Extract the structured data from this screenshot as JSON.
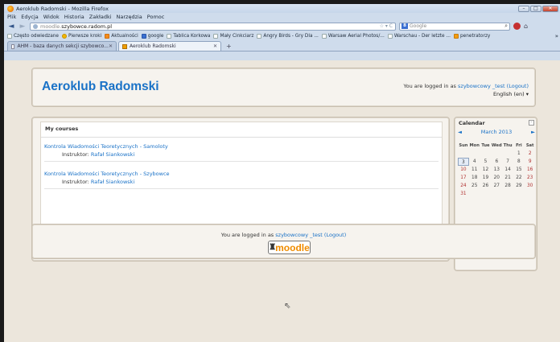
{
  "window": {
    "title": "Aeroklub Radomski - Mozilla Firefox",
    "buttons": {
      "minimize": "–",
      "maximize": "□",
      "close": "✕"
    }
  },
  "menu": [
    "Plik",
    "Edycja",
    "Widok",
    "Historia",
    "Zakładki",
    "Narzędzia",
    "Pomoc"
  ],
  "nav": {
    "url_host": "moodle.",
    "url_domain": "szybowce.radom.pl",
    "url_right": "☆ ▾ C",
    "search_placeholder": "Google",
    "search_engine_letter": "8"
  },
  "bookmarks": [
    {
      "label": "Często odwiedzane",
      "icon": "bookmark-icon"
    },
    {
      "label": "Pierwsze kroki",
      "icon": "star-icon"
    },
    {
      "label": "Aktualności",
      "icon": "rss-icon"
    },
    {
      "label": "google",
      "icon": "google-icon"
    },
    {
      "label": "Tablica Korkowa",
      "icon": "page-icon"
    },
    {
      "label": "Mały Cinkciarz",
      "icon": "page-icon"
    },
    {
      "label": "Angry Birds - Gry Dla ...",
      "icon": "page-icon"
    },
    {
      "label": "Warsaw Aerial Photos/...",
      "icon": "page-icon"
    },
    {
      "label": "Warschau - Der letzte ...",
      "icon": "page-icon"
    },
    {
      "label": "penetratorzy",
      "icon": "blogger-icon"
    }
  ],
  "tabs": [
    {
      "label": "AHM - baza danych sekcji szybowco...",
      "active": false
    },
    {
      "label": "Aeroklub Radomski",
      "active": true
    }
  ],
  "page": {
    "site_title": "Aeroklub Radomski",
    "login_prefix": "You are logged in as",
    "login_user": "szybowcowy _test",
    "logout": "(Logout)",
    "language": "English (en) ▾",
    "courses_title": "My courses",
    "courses": [
      {
        "name": "Kontrola Wiadomości Teoretycznych - Samoloty",
        "teacher_label": "Instruktor:",
        "teacher": "Rafał Siankowski"
      },
      {
        "name": "Kontrola Wiadomości Teoretycznych - Szybowce",
        "teacher_label": "Instruktor:",
        "teacher": "Rafał Siankowski"
      }
    ],
    "calendar": {
      "title": "Calendar",
      "month": "March 2013",
      "prev": "◄",
      "next": "►",
      "weekdays": [
        "Sun",
        "Mon",
        "Tue",
        "Wed",
        "Thu",
        "Fri",
        "Sat"
      ],
      "weeks": [
        [
          "",
          "",
          "",
          "",
          "",
          "1",
          "2"
        ],
        [
          "3",
          "4",
          "5",
          "6",
          "7",
          "8",
          "9"
        ],
        [
          "10",
          "11",
          "12",
          "13",
          "14",
          "15",
          "16"
        ],
        [
          "17",
          "18",
          "19",
          "20",
          "21",
          "22",
          "23"
        ],
        [
          "24",
          "25",
          "26",
          "27",
          "28",
          "29",
          "30"
        ],
        [
          "31",
          "",
          "",
          "",
          "",
          "",
          ""
        ]
      ],
      "today": "3"
    },
    "footer_logo": "moodle"
  },
  "colors": {
    "link": "#1a72c7",
    "page_bg": "#ece6dc",
    "weekend": "#b03030"
  }
}
